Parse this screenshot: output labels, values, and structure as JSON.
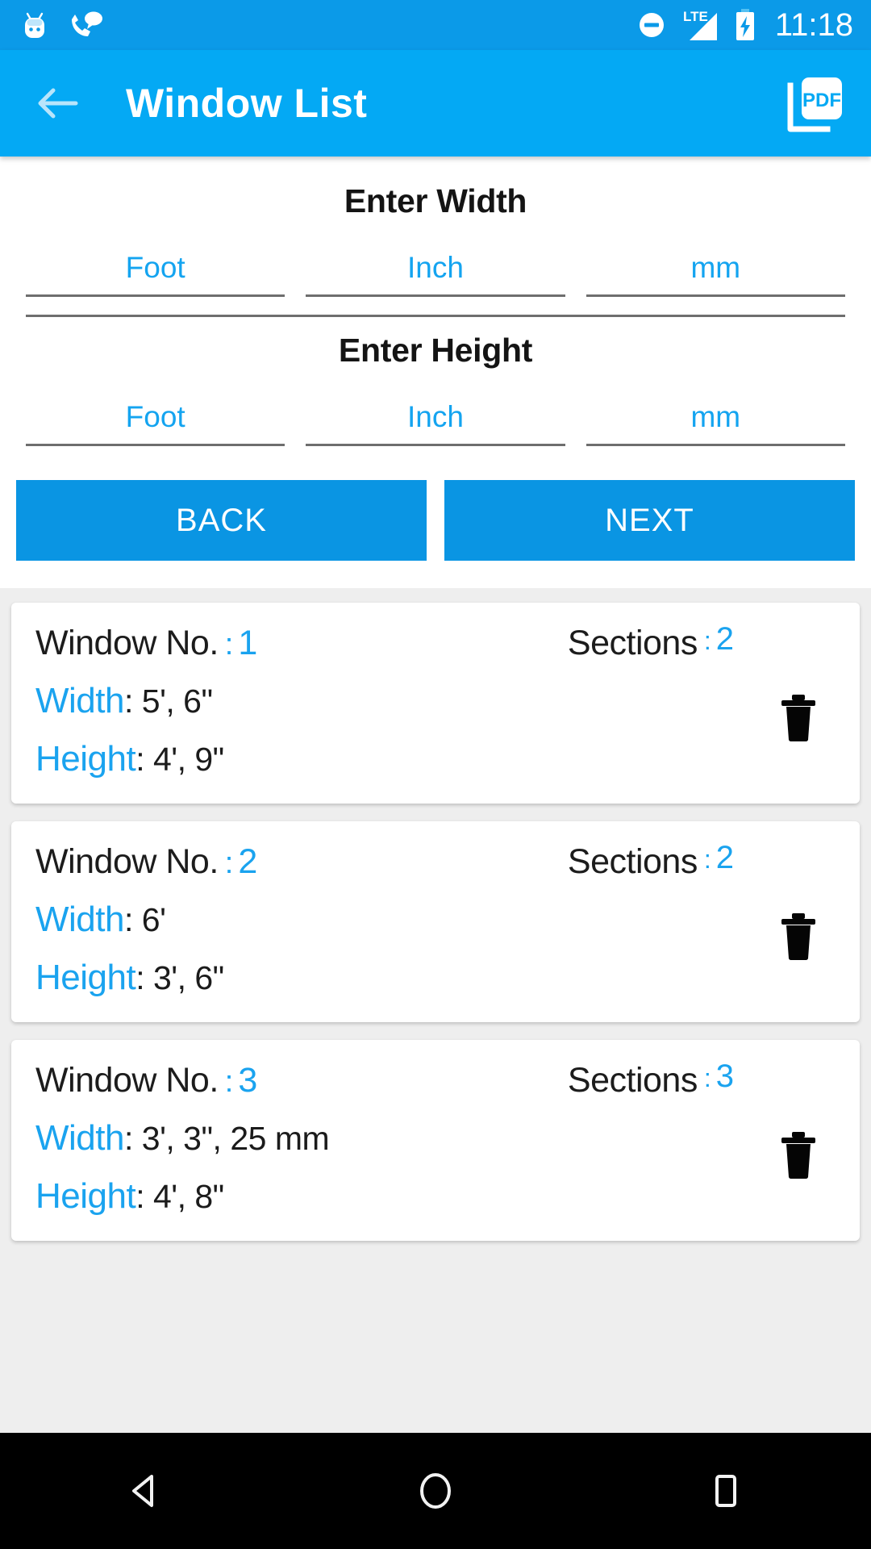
{
  "status_bar": {
    "icons": [
      "android-robot-icon",
      "missed-call-icon",
      "do-not-disturb-icon",
      "lte-signal-icon",
      "battery-charging-icon"
    ],
    "lte_label": "LTE",
    "time": "11:18",
    "background_color": "#0b9ae8"
  },
  "app_bar": {
    "back_label": "back-arrow-icon",
    "title": "Window List",
    "pdf_label": "PDF",
    "background_color": "#04a9f4"
  },
  "form": {
    "width_section_label": "Enter Width",
    "height_section_label": "Enter Height",
    "width_fields": [
      {
        "name": "foot",
        "placeholder": "Foot",
        "value": ""
      },
      {
        "name": "inch",
        "placeholder": "Inch",
        "value": ""
      },
      {
        "name": "mm",
        "placeholder": "mm",
        "value": ""
      }
    ],
    "height_fields": [
      {
        "name": "foot",
        "placeholder": "Foot",
        "value": ""
      },
      {
        "name": "inch",
        "placeholder": "Inch",
        "value": ""
      },
      {
        "name": "mm",
        "placeholder": "mm",
        "value": ""
      }
    ],
    "placeholder_color": "#14a4f0"
  },
  "buttons": {
    "back_label": "BACK",
    "next_label": "NEXT",
    "color": "#0a95e3"
  },
  "list": {
    "window_no_label": "Window No.",
    "sections_label": "Sections",
    "width_label": "Width",
    "height_label": "Height",
    "colon": ":",
    "accent_color": "#1aa3ef",
    "items": [
      {
        "window_no": "1",
        "sections": "2",
        "width": "5', 6\"",
        "height": "4', 9\""
      },
      {
        "window_no": "2",
        "sections": "2",
        "width": "6'",
        "height": "3', 6\""
      },
      {
        "window_no": "3",
        "sections": "3",
        "width": "3', 3\", 25 mm",
        "height": "4', 8\""
      }
    ]
  },
  "nav_bar": {
    "back": "nav-back-icon",
    "home": "nav-home-icon",
    "recents": "nav-recents-icon"
  }
}
